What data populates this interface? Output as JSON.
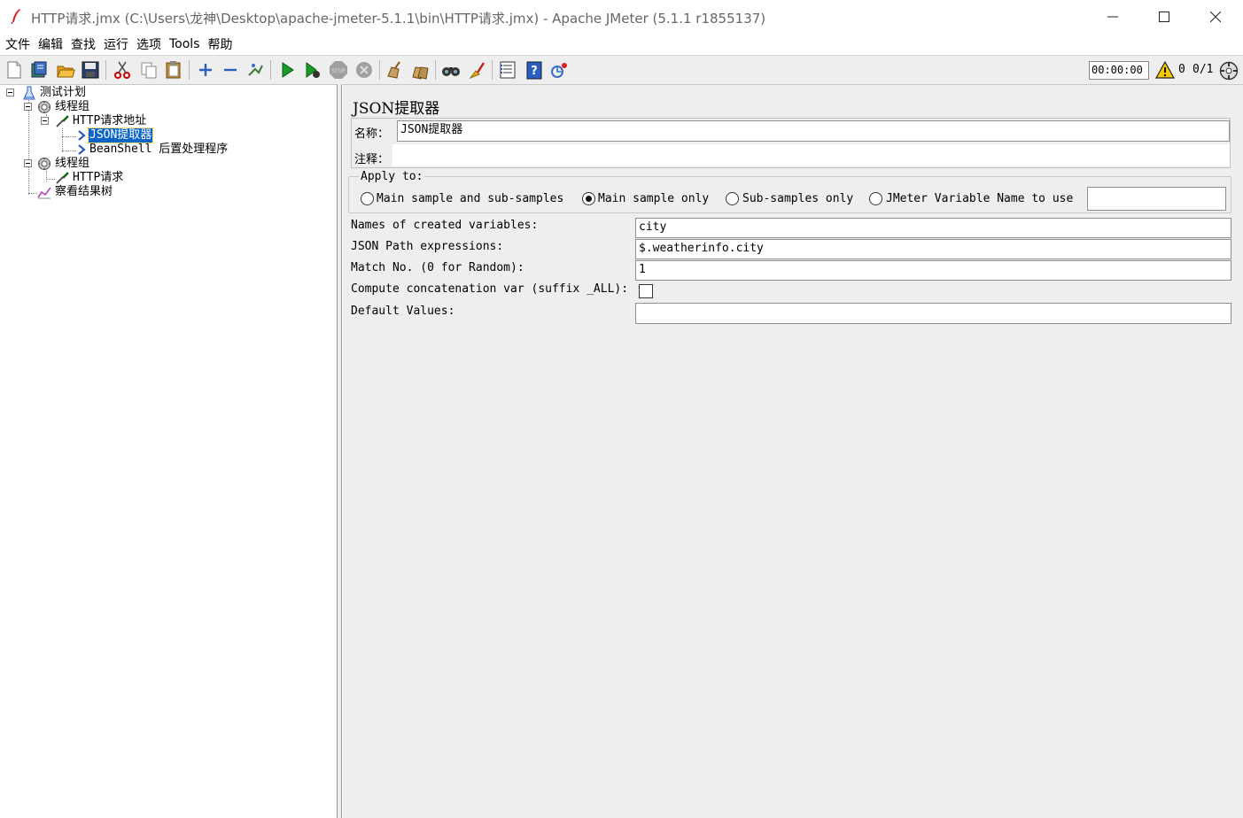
{
  "window": {
    "title": "HTTP请求.jmx (C:\\Users\\龙神\\Desktop\\apache-jmeter-5.1.1\\bin\\HTTP请求.jmx) - Apache JMeter (5.1.1 r1855137)"
  },
  "menu": [
    "文件",
    "编辑",
    "查找",
    "运行",
    "选项",
    "Tools",
    "帮助"
  ],
  "toolbar": {
    "icons": [
      "new-icon",
      "templates-icon",
      "open-icon",
      "save-icon",
      "cut-icon",
      "copy-icon",
      "paste-icon",
      "expand-icon",
      "collapse-icon",
      "toggle-icon",
      "start-icon",
      "start-no-pause-icon",
      "stop-icon",
      "shutdown-icon",
      "clear-icon",
      "clear-all-icon",
      "search-icon",
      "reset-search-icon",
      "function-helper-icon",
      "help-icon",
      "remote-icon"
    ],
    "timer": "00:00:00",
    "warning_count": "0",
    "threads": "0/1"
  },
  "tree": {
    "items": [
      {
        "label": "测试计划",
        "icon": "test-plan-icon"
      },
      {
        "label": "线程组",
        "icon": "thread-group-icon"
      },
      {
        "label": "HTTP请求地址",
        "icon": "sampler-icon"
      },
      {
        "label": "JSON提取器",
        "icon": "post-processor-icon",
        "selected": true
      },
      {
        "label": "BeanShell 后置处理程序",
        "icon": "post-processor-icon"
      },
      {
        "label": "线程组",
        "icon": "thread-group-icon"
      },
      {
        "label": "HTTP请求",
        "icon": "sampler-icon"
      },
      {
        "label": "察看结果树",
        "icon": "listener-icon"
      }
    ]
  },
  "panel": {
    "title": "JSON提取器",
    "name_label": "名称：",
    "name_value": "JSON提取器",
    "comment_label": "注释：",
    "comment_value": "",
    "apply_to": {
      "legend": "Apply to:",
      "options": [
        "Main sample and sub-samples",
        "Main sample only",
        "Sub-samples only",
        "JMeter Variable Name to use"
      ],
      "selected": "Main sample only",
      "variable_name": ""
    },
    "fields": {
      "names_label": "Names of created variables:",
      "names_value": "city",
      "path_label": "JSON Path expressions:",
      "path_value": "$.weatherinfo.city",
      "match_label": "Match No. (0 for Random):",
      "match_value": "1",
      "concat_label": "Compute concatenation var (suffix _ALL):",
      "concat_checked": false,
      "default_label": "Default Values:",
      "default_value": ""
    }
  },
  "colors": {
    "selection": "#0a64c8",
    "panel_bg": "#eeeeee",
    "start_green": "#1a9a2a"
  }
}
